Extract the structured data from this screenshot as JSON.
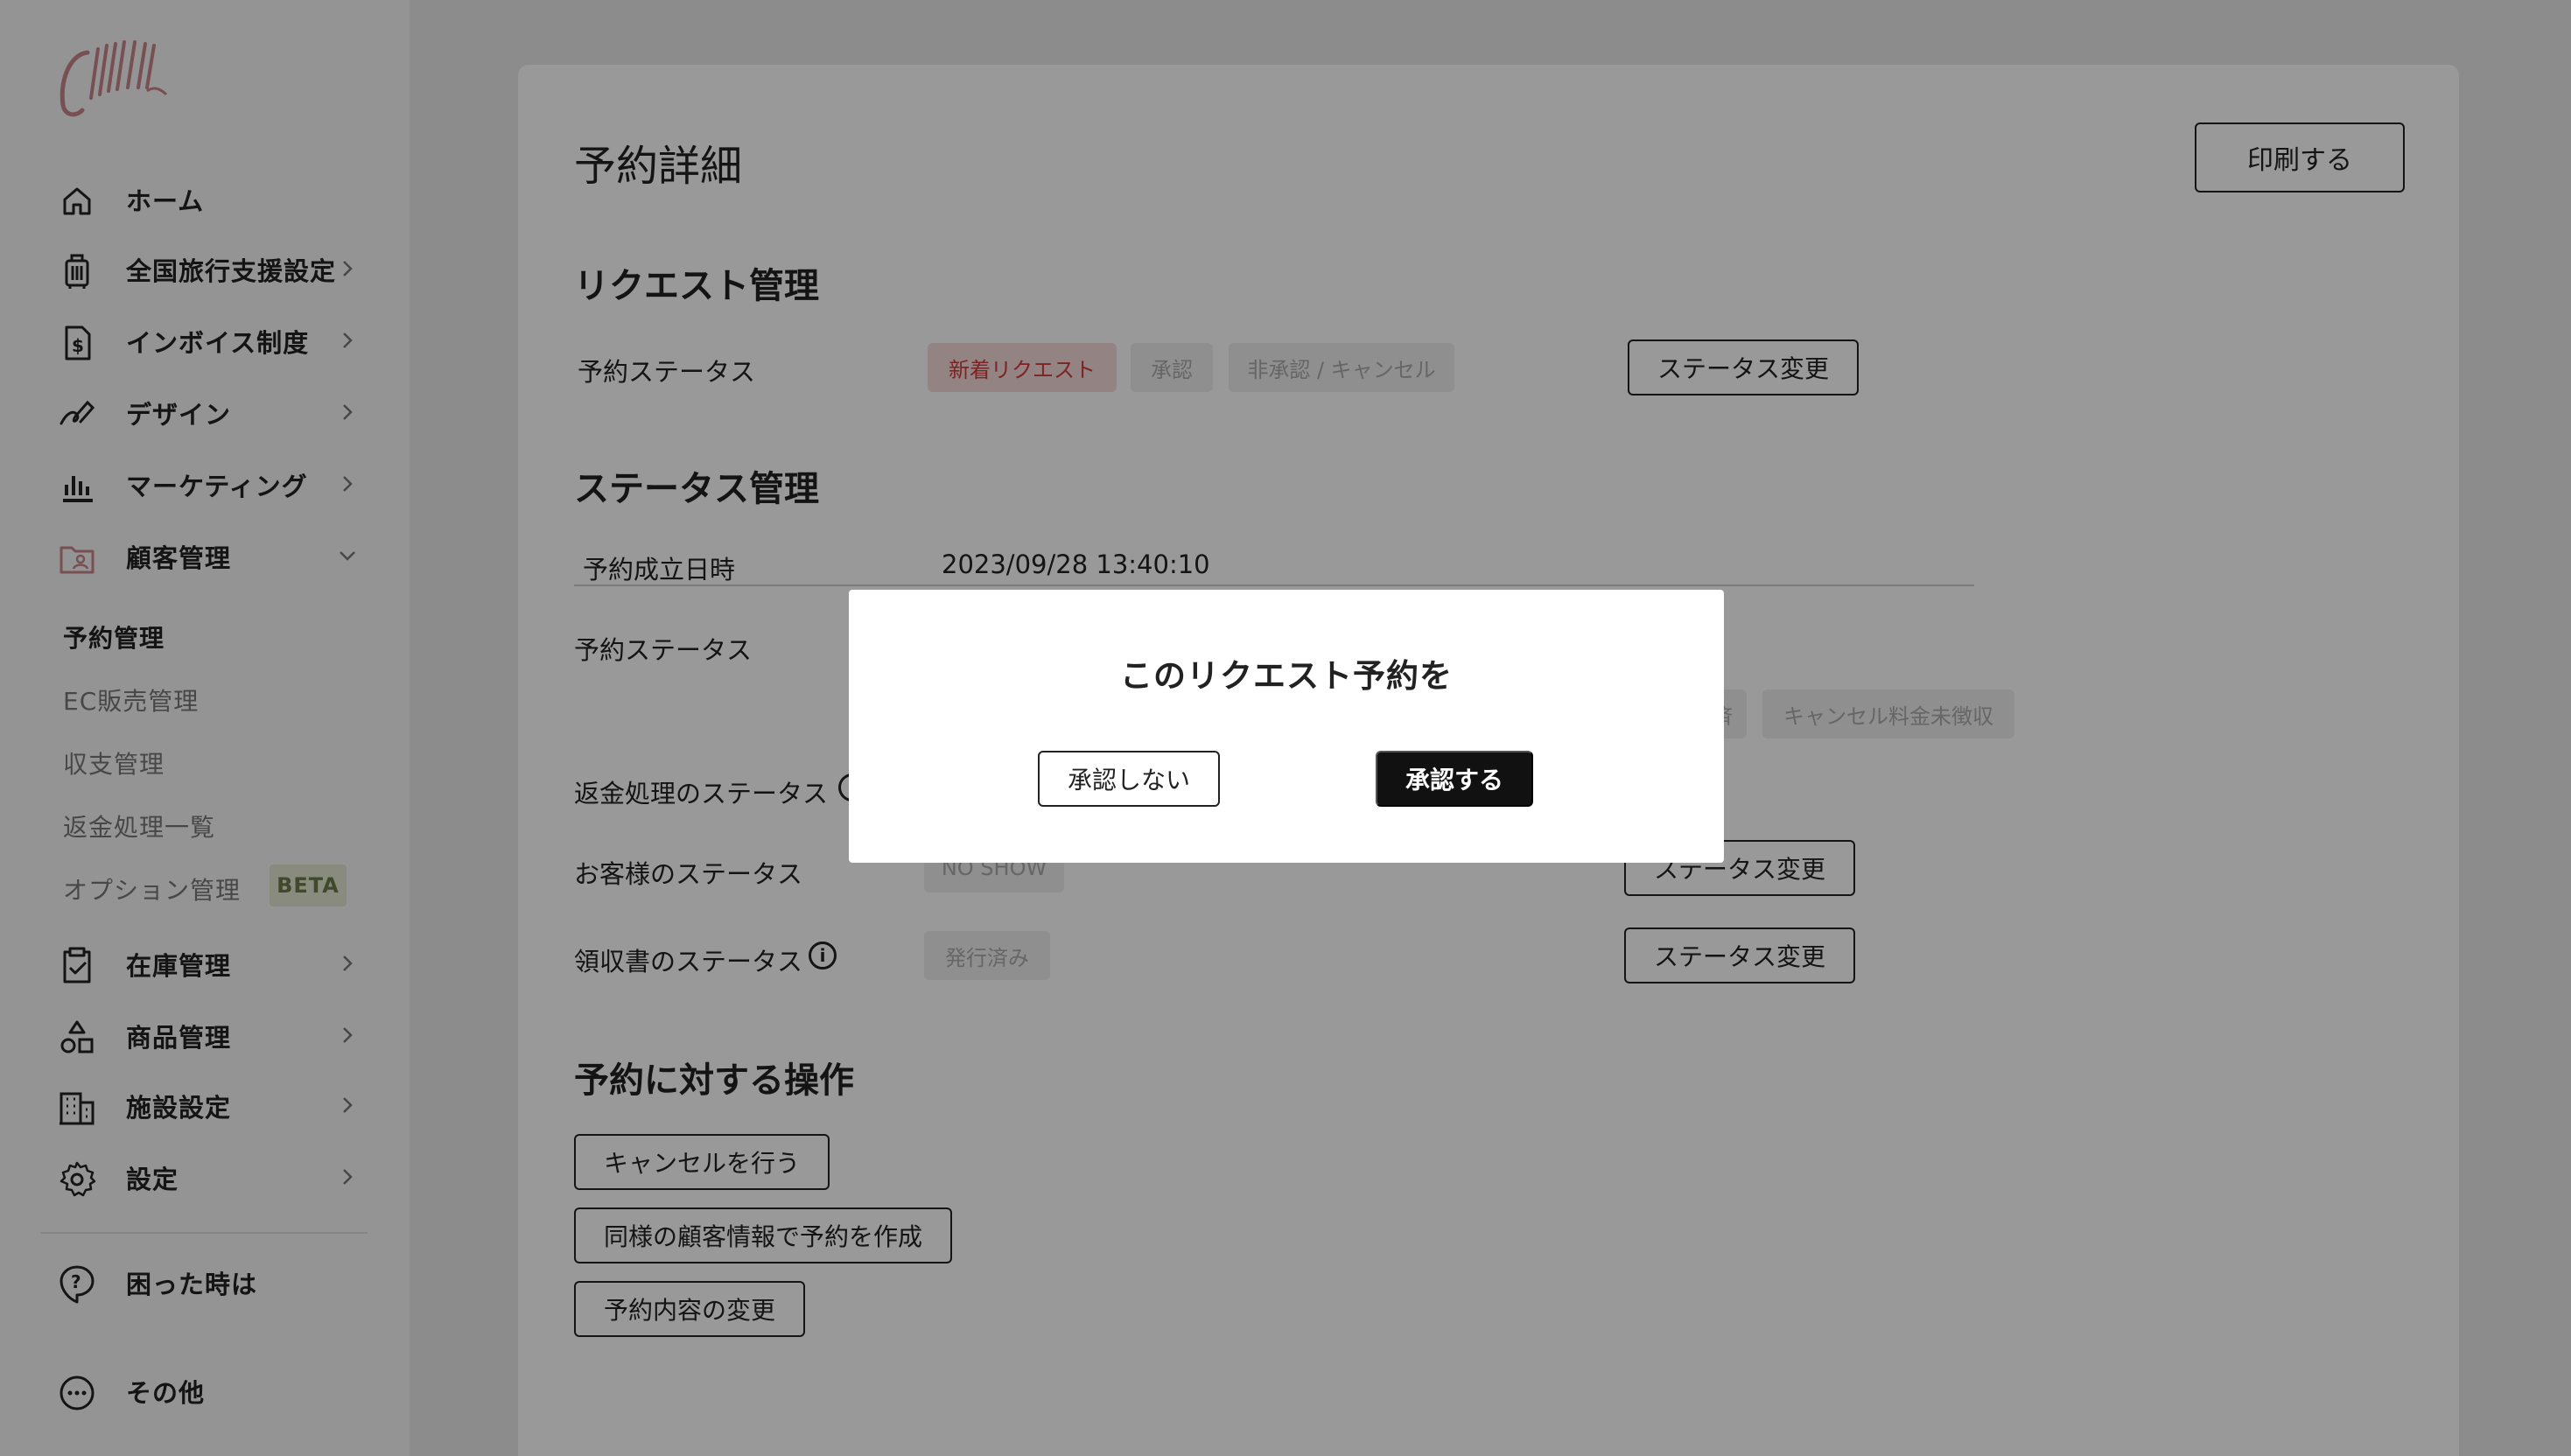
{
  "sidebar": {
    "logo_text": "Chillin",
    "items": [
      {
        "label": "ホーム",
        "icon": "home-icon"
      },
      {
        "label": "全国旅行支援設定",
        "icon": "suitcase-icon"
      },
      {
        "label": "インボイス制度",
        "icon": "invoice-icon"
      },
      {
        "label": "デザイン",
        "icon": "design-icon"
      },
      {
        "label": "マーケティング",
        "icon": "bar-chart-icon"
      },
      {
        "label": "顧客管理",
        "icon": "customer-folder-icon"
      },
      {
        "label": "在庫管理",
        "icon": "clipboard-check-icon"
      },
      {
        "label": "商品管理",
        "icon": "shapes-icon"
      },
      {
        "label": "施設設定",
        "icon": "building-icon"
      },
      {
        "label": "設定",
        "icon": "gear-icon"
      },
      {
        "label": "困った時は",
        "icon": "help-icon"
      },
      {
        "label": "その他",
        "icon": "more-icon"
      }
    ],
    "sub_items": [
      {
        "label": "予約管理"
      },
      {
        "label": "EC販売管理"
      },
      {
        "label": "収支管理"
      },
      {
        "label": "返金処理一覧"
      },
      {
        "label": "オプション管理"
      }
    ],
    "beta_badge": "BETA"
  },
  "main": {
    "title": "予約詳細",
    "print_button": "印刷する",
    "request_section": {
      "title": "リクエスト管理",
      "row_label": "予約ステータス",
      "chips": [
        "新着リクエスト",
        "承認",
        "非承認 / キャンセル"
      ],
      "change_button": "ステータス変更"
    },
    "status_section": {
      "title": "ステータス管理",
      "established_label": "予約成立日時",
      "established_value": "2023/09/28 13:40:10",
      "reservation_status_label": "予約ステータス",
      "reservation_chips_visible": [
        "済",
        "キャンセル料金未徴収"
      ],
      "refund_label": "返金処理のステータス",
      "customer_label": "お客様のステータス",
      "customer_chip": "NO SHOW",
      "customer_change_button": "ステータス変更",
      "receipt_label": "領収書のステータス",
      "receipt_chip": "発行済み",
      "receipt_change_button": "ステータス変更"
    },
    "actions_section": {
      "title": "予約に対する操作",
      "buttons": [
        "キャンセルを行う",
        "同様の顧客情報で予約を作成",
        "予約内容の変更"
      ]
    }
  },
  "modal": {
    "title": "このリクエスト予約を",
    "reject_button": "承認しない",
    "approve_button": "承認する"
  },
  "colors": {
    "accent_red": "#d13b3b",
    "chip_red_bg": "#f7dada",
    "logo_pink": "#c9868a",
    "beta_bg": "#e3e8d3",
    "overlay": "rgba(0,0,0,0.40)"
  }
}
